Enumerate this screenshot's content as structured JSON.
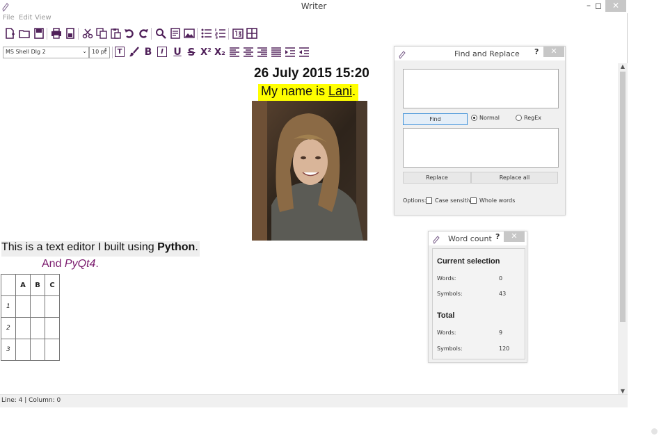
{
  "window": {
    "title": "Writer"
  },
  "window_controls": {
    "minimize": "–",
    "maximize": "◻",
    "close": "✕"
  },
  "menu": [
    "File",
    "Edit",
    "View"
  ],
  "toolbar_main": [
    {
      "icon": "new-file-icon"
    },
    {
      "icon": "open-folder-icon"
    },
    {
      "icon": "save-icon"
    },
    {
      "icon": "print-icon"
    },
    {
      "icon": "print-preview-icon"
    },
    {
      "icon": "cut-icon"
    },
    {
      "icon": "copy-icon"
    },
    {
      "icon": "paste-icon"
    },
    {
      "icon": "undo-icon"
    },
    {
      "icon": "redo-icon"
    },
    {
      "icon": "find-icon"
    },
    {
      "icon": "insert-time-icon"
    },
    {
      "icon": "insert-image-icon"
    },
    {
      "icon": "bullet-list-icon"
    },
    {
      "icon": "numbered-list-icon"
    },
    {
      "icon": "word-count-icon"
    },
    {
      "icon": "insert-table-icon"
    }
  ],
  "format_toolbar": {
    "font_family": "MS Shell Dlg 2",
    "font_size": "10 pt",
    "text_color_label": "T",
    "bold": "B",
    "italic": "I",
    "underline": "U",
    "strike": "S",
    "superscript": "X²",
    "subscript": "X₂"
  },
  "document": {
    "date_heading": "26 July 2015 15:20",
    "name_prefix": "My name is ",
    "name_value": "Lani",
    "name_suffix": ".",
    "line1_text": "This is a text editor I built using ",
    "line1_bold": "Python",
    "line1_end": ".",
    "line2_text": "And ",
    "line2_italic": "PyQt4",
    "line2_end": ".",
    "table": {
      "columns": [
        "A",
        "B",
        "C"
      ],
      "rows": [
        "1",
        "2",
        "3"
      ]
    }
  },
  "status": "Line: 4 | Column: 0",
  "find_dialog": {
    "title": "Find and Replace",
    "help": "?",
    "close": "✕",
    "find_label": "Find",
    "radio_normal": "Normal",
    "radio_regex": "RegEx",
    "selected_mode": "Normal",
    "replace_label": "Replace",
    "replace_all_label": "Replace all",
    "options_label": "Options:",
    "case_sensitive": "Case sensitive",
    "whole_words": "Whole words"
  },
  "word_count_dialog": {
    "title": "Word count",
    "help": "?",
    "close": "✕",
    "current_heading": "Current selection",
    "total_heading": "Total",
    "words_label": "Words:",
    "symbols_label": "Symbols:",
    "current_words": "0",
    "current_symbols": "43",
    "total_words": "9",
    "total_symbols": "120"
  },
  "colors": {
    "accent": "#50215a",
    "highlight": "#ffff00",
    "purple_text": "#7a1a6d"
  }
}
